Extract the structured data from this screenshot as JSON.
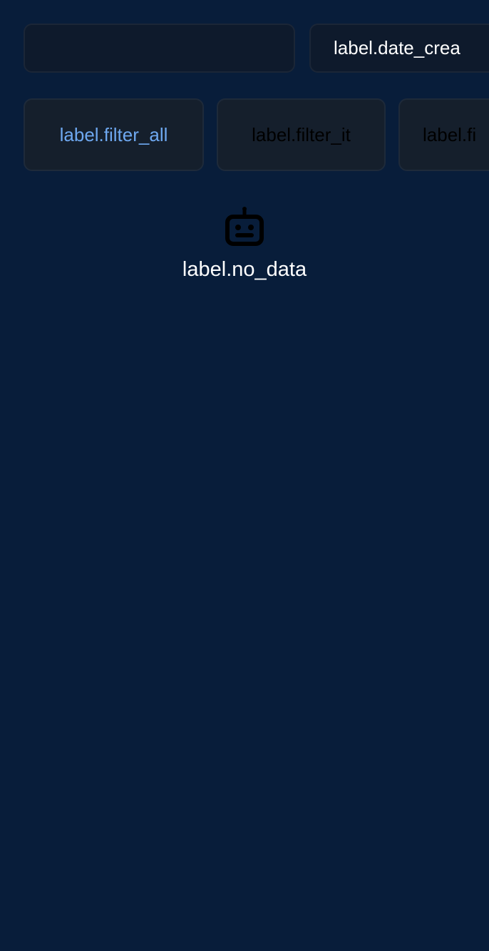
{
  "toolbar": {
    "search_value": "",
    "date_label": "label.date_crea"
  },
  "filters": [
    {
      "label": "label.filter_all",
      "active": true
    },
    {
      "label": "label.filter_it",
      "active": false
    },
    {
      "label": "label.fi",
      "active": false
    }
  ],
  "empty_state": {
    "icon": "robot-icon",
    "text": "label.no_data"
  },
  "colors": {
    "background": "#081d3a",
    "active_filter_text": "#6ea8f0",
    "chip_background": "#151f2c",
    "text": "#ffffff"
  }
}
